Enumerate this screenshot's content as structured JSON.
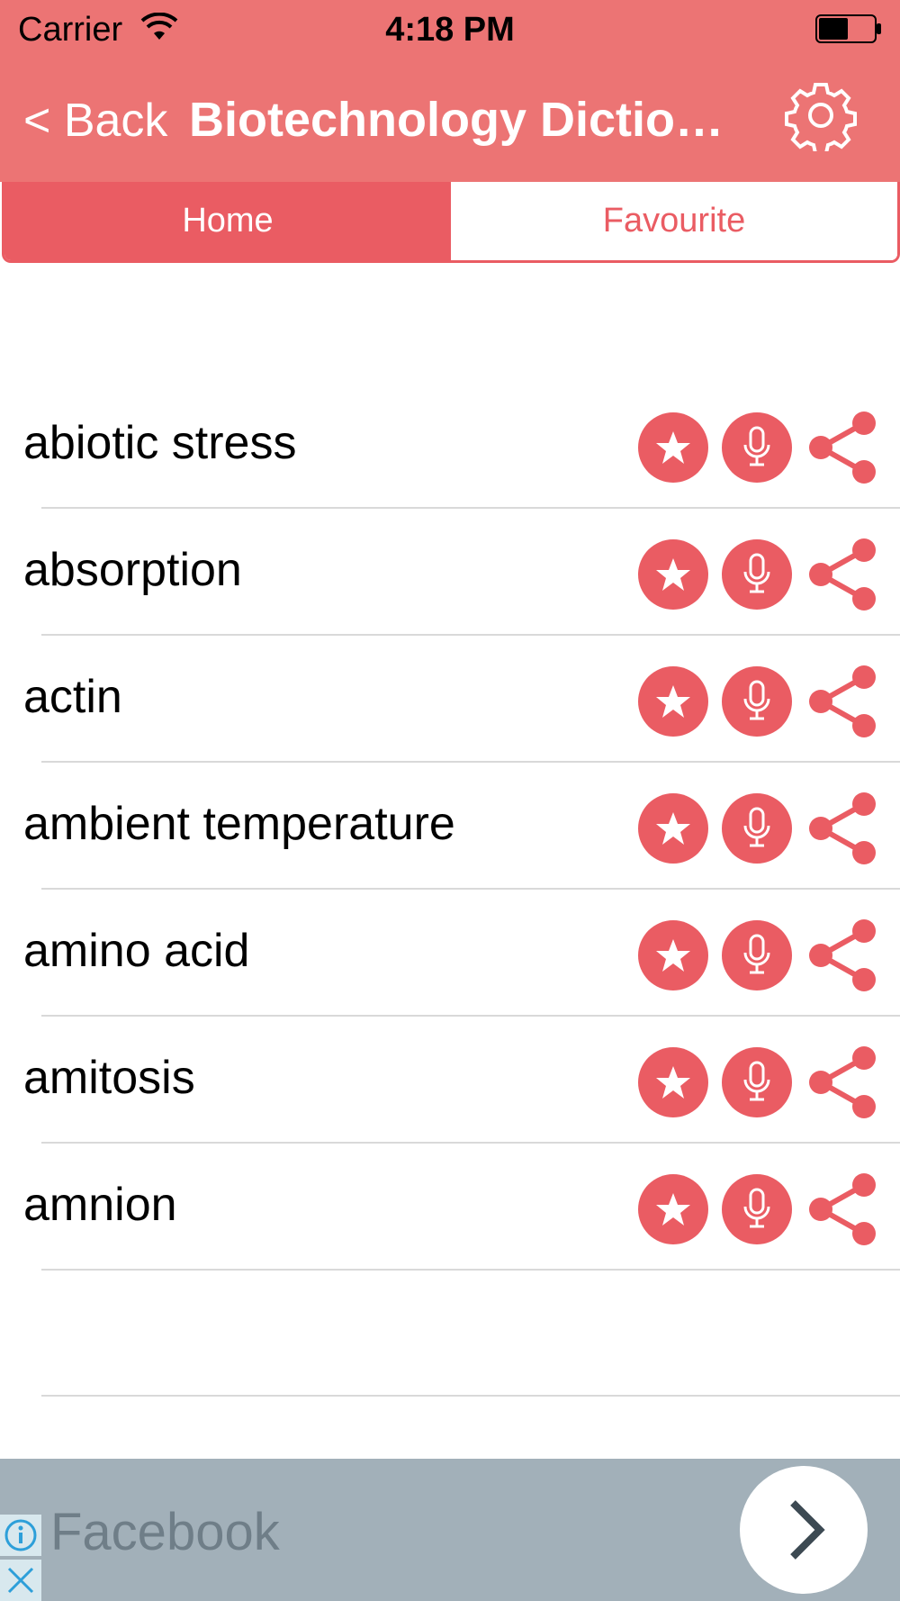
{
  "status_bar": {
    "carrier": "Carrier",
    "time": "4:18 PM"
  },
  "nav": {
    "back_label": "< Back",
    "title": "Biotechnology Diction..."
  },
  "tabs": [
    {
      "label": "Home",
      "active": true
    },
    {
      "label": "Favourite",
      "active": false
    }
  ],
  "words": [
    "abiotic stress",
    "absorption",
    "actin",
    "ambient temperature",
    "amino acid",
    "amitosis",
    "amnion"
  ],
  "ad": {
    "text": "Facebook"
  },
  "colors": {
    "nav_bg": "#ec7474",
    "accent": "#ea5c63",
    "ad_bg": "#a2b0b9"
  },
  "icons": {
    "favourite": "star-icon",
    "pronounce": "microphone-icon",
    "share": "share-icon",
    "settings": "gear-icon"
  }
}
